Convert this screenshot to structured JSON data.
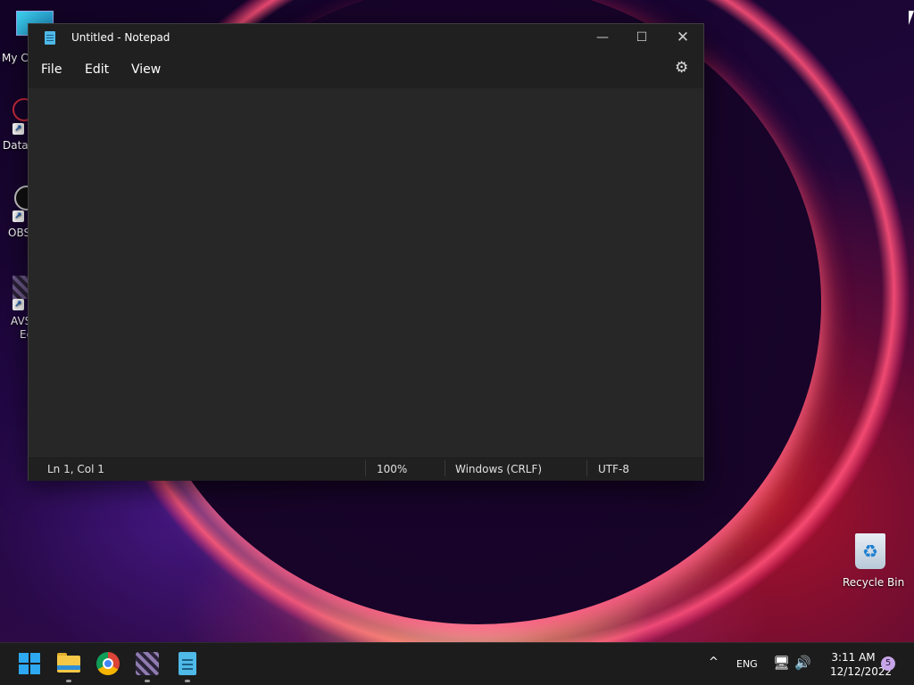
{
  "desktop": {
    "icons": [
      {
        "label": "My C"
      },
      {
        "label": "DataW"
      },
      {
        "label": "OBS"
      },
      {
        "label": "AVS",
        "label2": "Ec"
      },
      {
        "label": "Recycle Bin"
      }
    ]
  },
  "window": {
    "title": "Untitled - Notepad",
    "controls": {
      "minimize": "—",
      "maximize": "☐",
      "close": "✕"
    },
    "menu": {
      "file": "File",
      "edit": "Edit",
      "view": "View"
    },
    "settings_icon": "⚙",
    "editor_text": "",
    "status": {
      "position": "Ln 1, Col 1",
      "zoom": "100%",
      "line_ending": "Windows (CRLF)",
      "encoding": "UTF-8"
    }
  },
  "taskbar": {
    "tray": {
      "chevron": "^",
      "language": "ENG",
      "network_icon": "🖥",
      "volume_icon": "🔊",
      "time": "3:11 AM",
      "date": "12/12/2022",
      "notification_count": "5"
    }
  },
  "colors": {
    "accent": "#2ea8f0",
    "window_bg": "#272727",
    "titlebar_bg": "#202020"
  }
}
